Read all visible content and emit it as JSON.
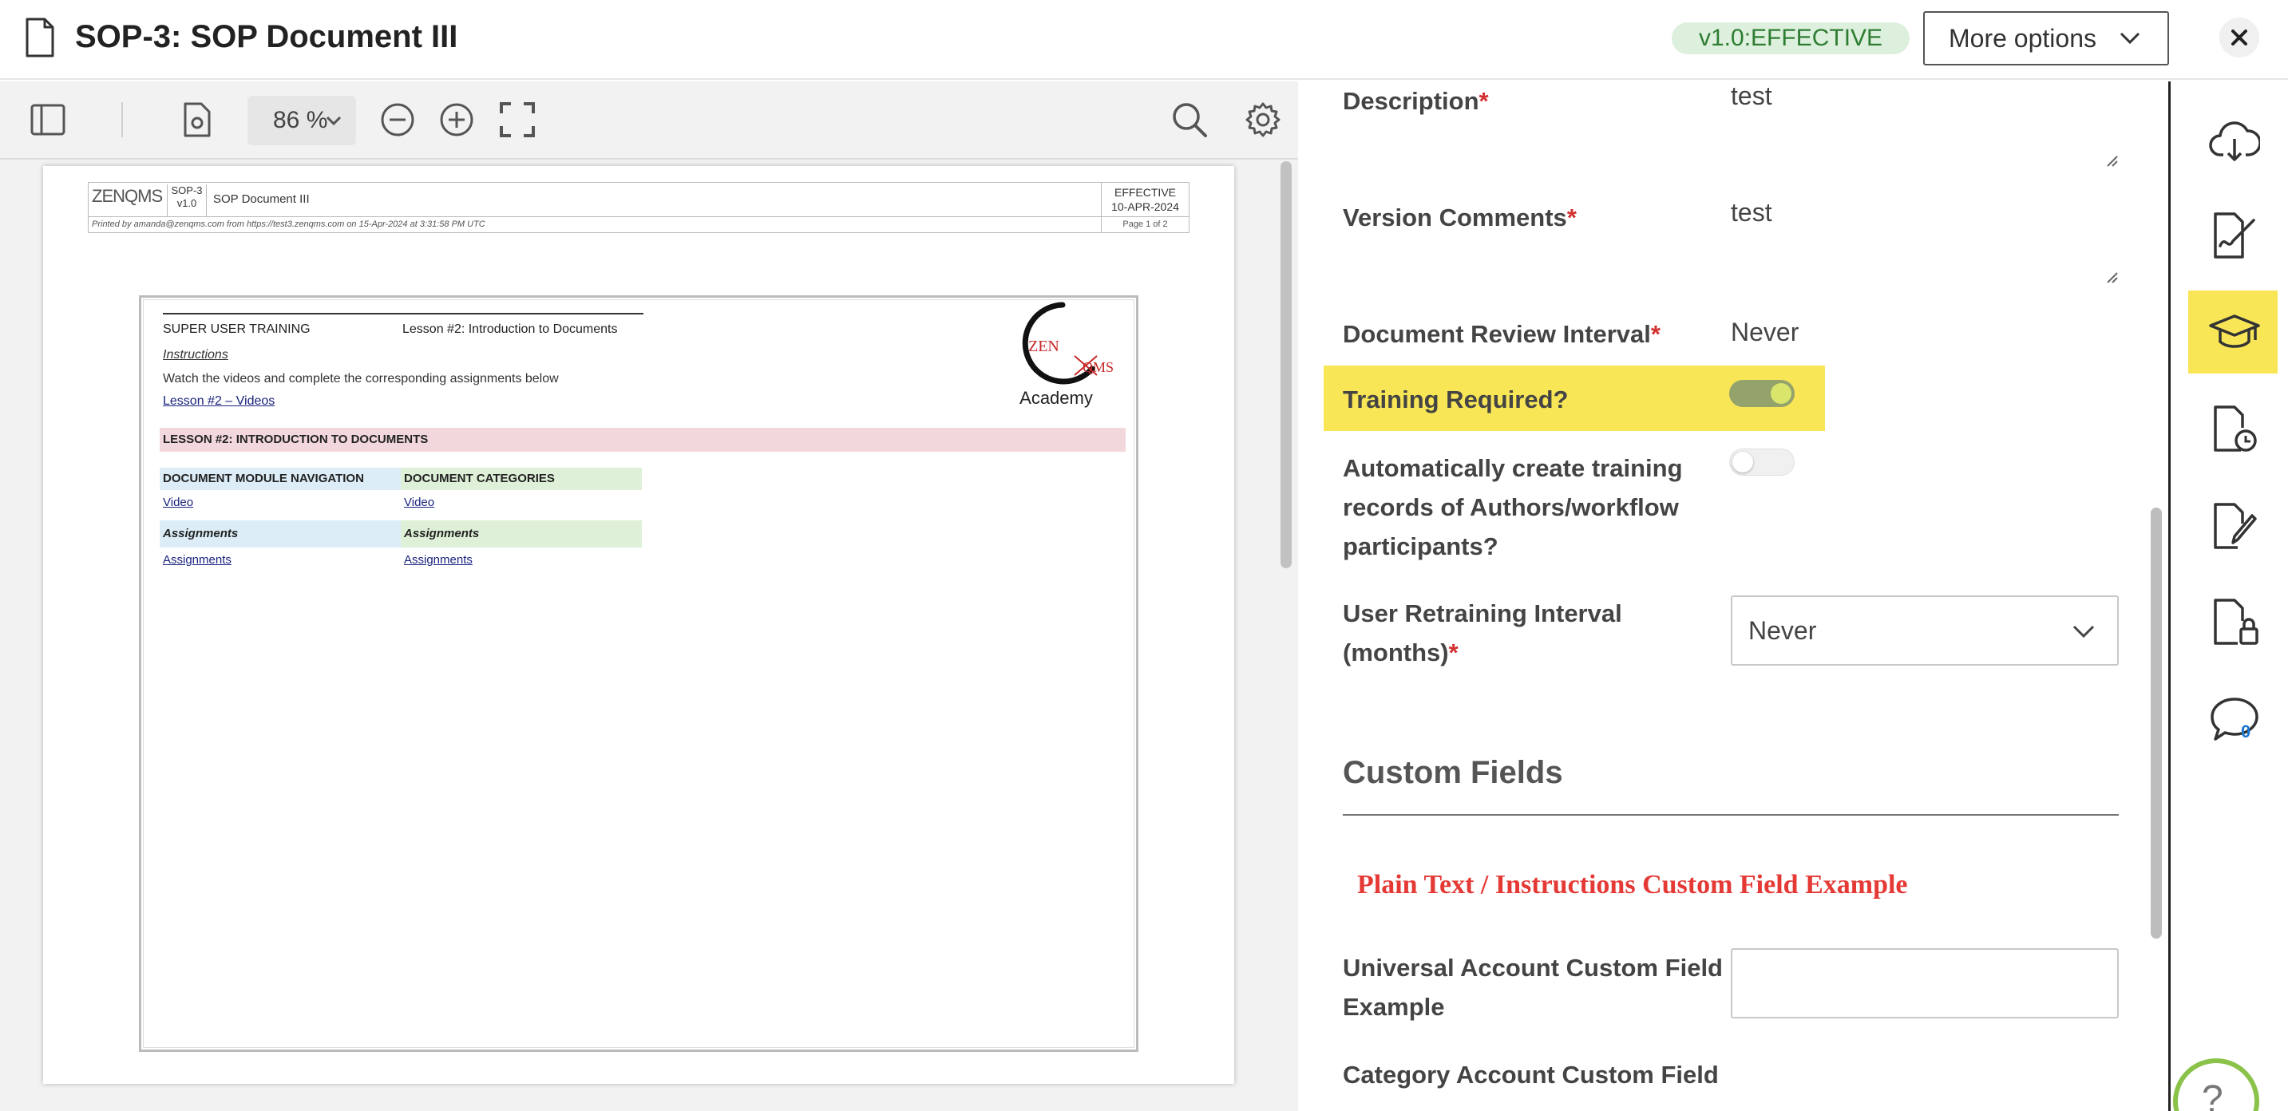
{
  "header": {
    "title": "SOP-3: SOP Document III",
    "version_badge": "v1.0:EFFECTIVE",
    "more_options_label": "More options"
  },
  "viewer_toolbar": {
    "zoom_level": "86 %"
  },
  "pdf": {
    "header": {
      "logo_text": "ZENQMS",
      "doc_id": "SOP-3",
      "doc_version": "v1.0",
      "doc_name": "SOP Document III",
      "status": "EFFECTIVE",
      "status_date": "10-APR-2024",
      "printed_by": "Printed by amanda@zenqms.com from https://test3.zenqms.com on 15-Apr-2024 at 3:31:58 PM UTC",
      "page_info": "Page 1 of 2"
    },
    "lesson": {
      "course": "SUPER USER TRAINING",
      "lesson_title": "Lesson #2: Introduction to Documents",
      "instructions_label": "Instructions",
      "instructions_text": "Watch the videos and complete the corresponding assignments below",
      "videos_link": "Lesson #2 – Videos",
      "academy_logo_top": "ZEN",
      "academy_logo_bottom": "QMS",
      "academy_label": "Academy",
      "section_bar": "LESSON #2: INTRODUCTION TO DOCUMENTS",
      "columns": [
        {
          "heading": "DOCUMENT MODULE NAVIGATION",
          "video_link": "Video",
          "assignments_heading": "Assignments",
          "assignments_link": "Assignments",
          "color": "#dcedf8"
        },
        {
          "heading": "DOCUMENT CATEGORIES",
          "video_link": "Video",
          "assignments_heading": "Assignments",
          "assignments_link": "Assignments",
          "color": "#dff0d8"
        }
      ]
    }
  },
  "panel": {
    "description": {
      "label": "Description",
      "value": "test"
    },
    "version_comments": {
      "label": "Version Comments",
      "value": "test"
    },
    "review_interval": {
      "label": "Document Review Interval",
      "value": "Never"
    },
    "training_required": {
      "label": "Training Required?",
      "on": true
    },
    "auto_training": {
      "label_line1": "Automatically create training",
      "label_line2": "records of Authors/workflow",
      "label_line3": "participants?",
      "on": false
    },
    "retraining_interval": {
      "label_line1": "User Retraining Interval",
      "label_line2": "(months)",
      "value": "Never"
    },
    "custom_fields": {
      "title": "Custom Fields",
      "plain_text": "Plain Text / Instructions Custom Field Example",
      "universal_label_line1": "Universal Account Custom Field",
      "universal_label_line2": "Example",
      "universal_value": "",
      "category_label": "Category Account Custom Field"
    },
    "required_marker": "*"
  },
  "rail": {
    "comment_count": "0",
    "help_symbol": "?"
  },
  "colors": {
    "highlight": "#f9e657",
    "badge_bg": "#ddefdd",
    "badge_text": "#2e7d32",
    "required": "#d32f2f",
    "plain_text": "#e53935",
    "toggle_on": "#94a26c"
  },
  "icons": [
    "document-icon",
    "chevron-down-icon",
    "close-icon",
    "sidebar-toggle-icon",
    "document-settings-icon",
    "zoom-out-icon",
    "zoom-in-icon",
    "fullscreen-icon",
    "search-icon",
    "gear-icon",
    "cloud-download-icon",
    "signature-icon",
    "graduation-cap-icon",
    "document-history-icon",
    "document-edit-icon",
    "document-lock-icon",
    "comment-icon",
    "help-icon"
  ]
}
